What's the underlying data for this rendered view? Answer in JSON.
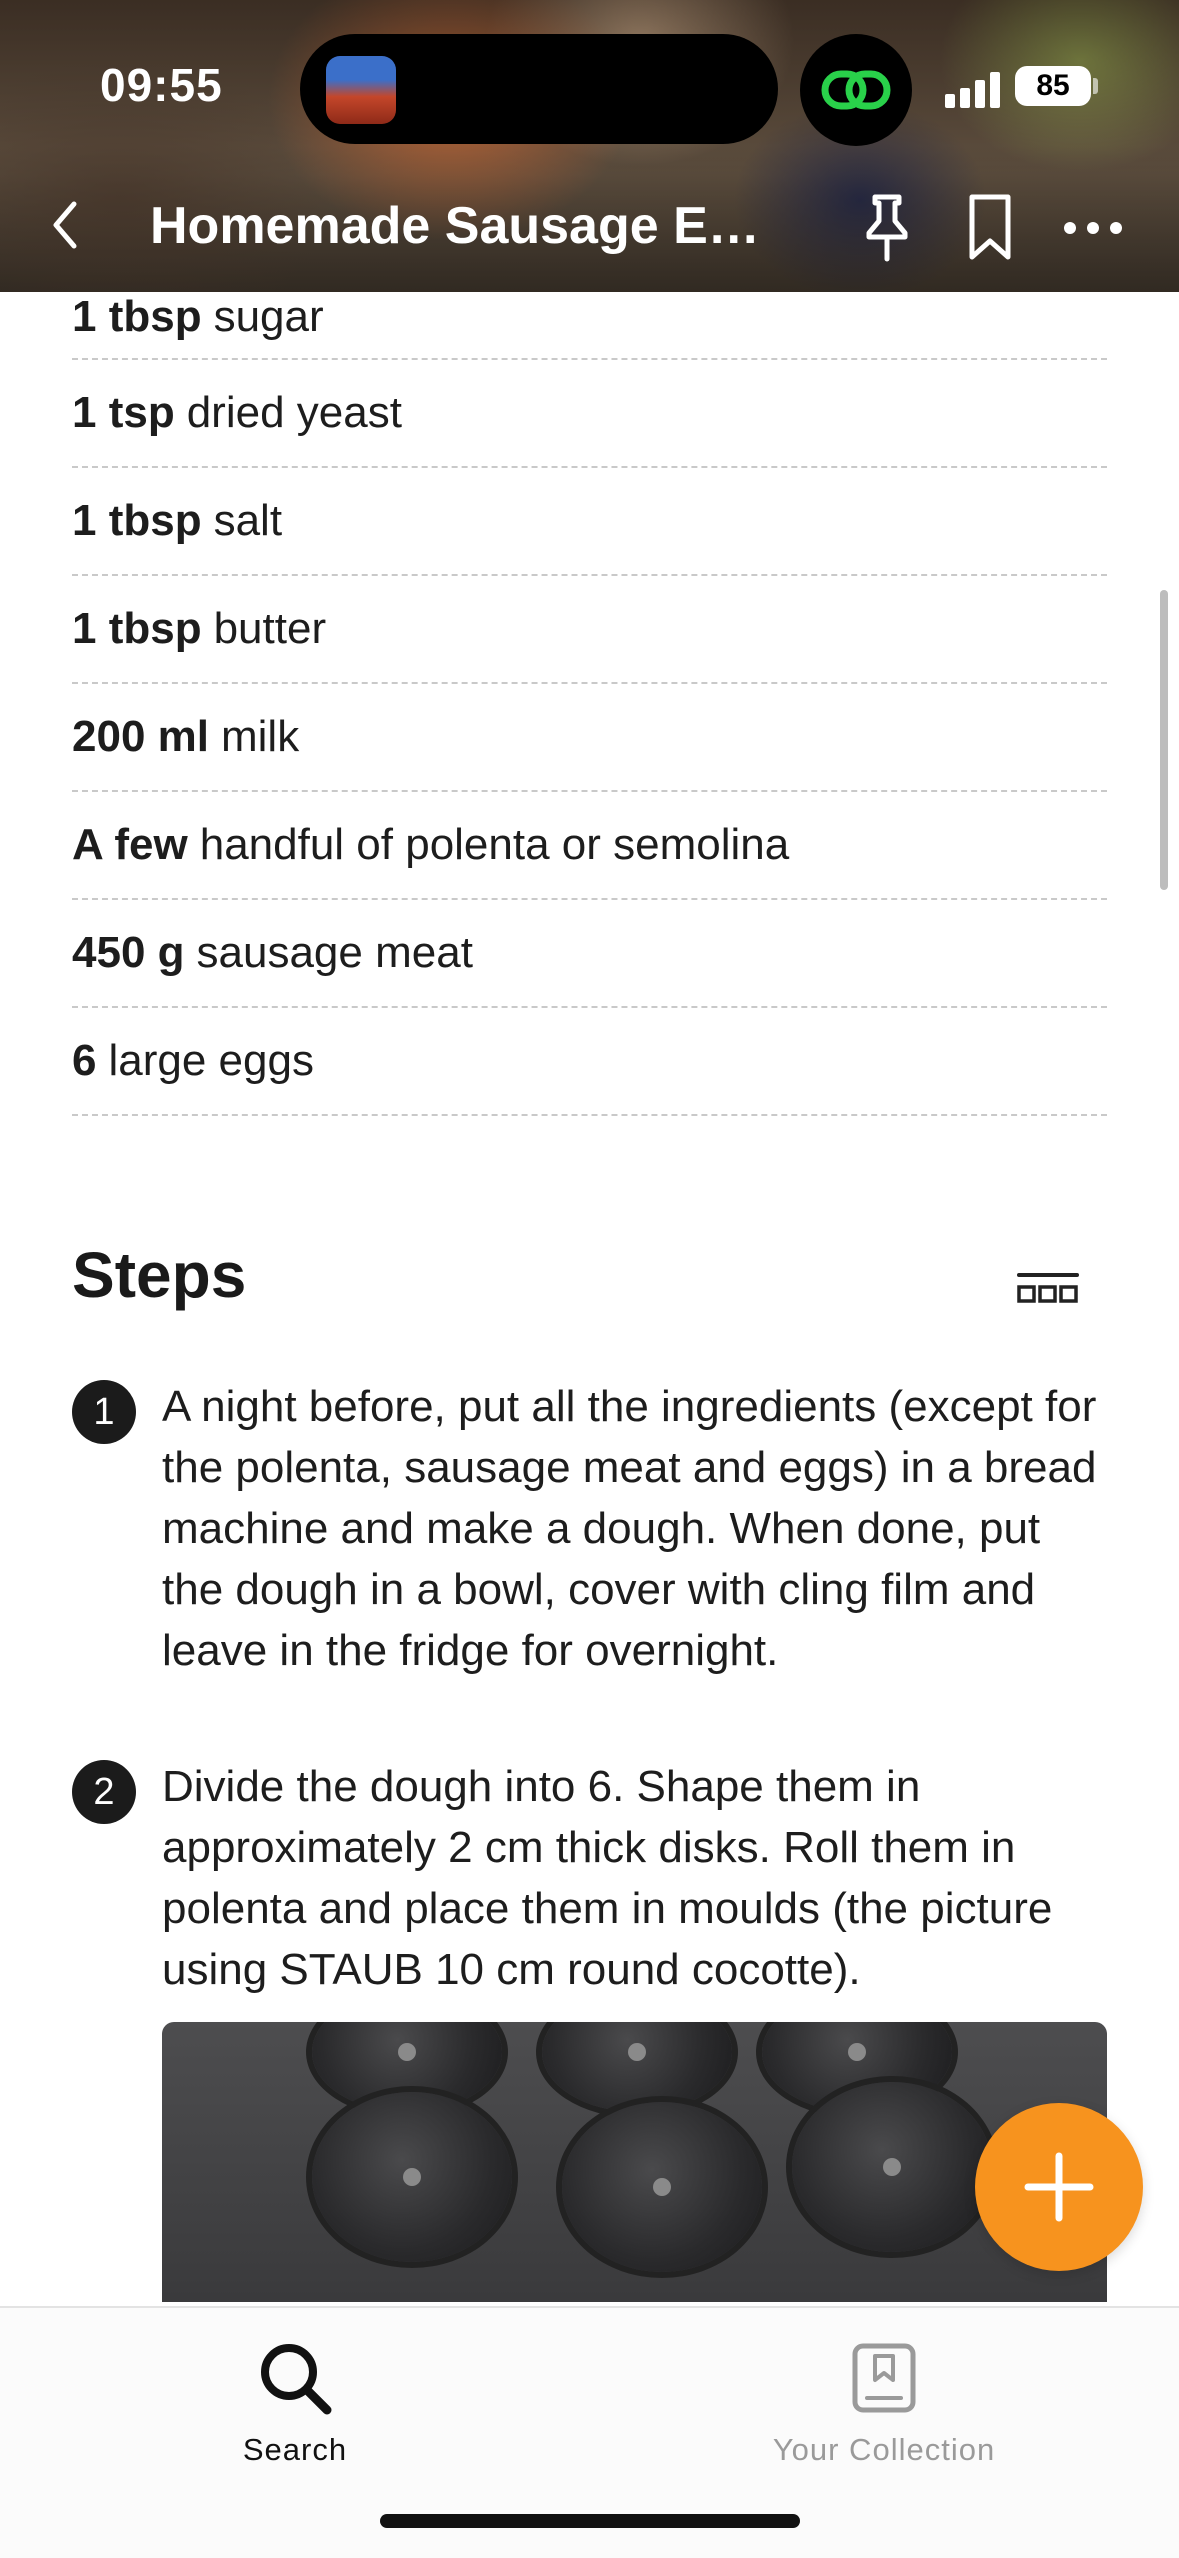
{
  "status_bar": {
    "time": "09:55",
    "battery": "85"
  },
  "nav": {
    "title": "Homemade Sausage Egg...",
    "icons": [
      "chevron-left-icon",
      "pin-icon",
      "bookmark-icon",
      "more-icon"
    ]
  },
  "ingredients": [
    {
      "qty": "1 tbsp",
      "name": "sugar"
    },
    {
      "qty": "1 tsp",
      "name": "dried yeast"
    },
    {
      "qty": "1 tbsp",
      "name": "salt"
    },
    {
      "qty": "1 tbsp",
      "name": "butter"
    },
    {
      "qty": "200 ml",
      "name": "milk"
    },
    {
      "qty": "A few",
      "name": "handful of polenta or semolina"
    },
    {
      "qty": "450 g",
      "name": "sausage meat"
    },
    {
      "qty": "6",
      "name": "large eggs"
    }
  ],
  "steps": {
    "title": "Steps",
    "items": [
      {
        "number": "1",
        "text": "A night before, put all the ingredients (except for the polenta, sausage meat and eggs) in a bread machine and make a dough. When done, put the dough in a bowl, cover with cling film and leave in the fridge for overnight."
      },
      {
        "number": "2",
        "text": "Divide the dough into 6. Shape them in approximately 2 cm thick disks. Roll them in polenta and place them in moulds (the picture using STAUB 10 cm round cocotte)."
      }
    ]
  },
  "tabbar": {
    "search_label": "Search",
    "collection_label": "Your Collection"
  },
  "colors": {
    "accent": "#f7931e",
    "text": "#1d1d1d",
    "inactive_tab": "#9a9a9a"
  }
}
